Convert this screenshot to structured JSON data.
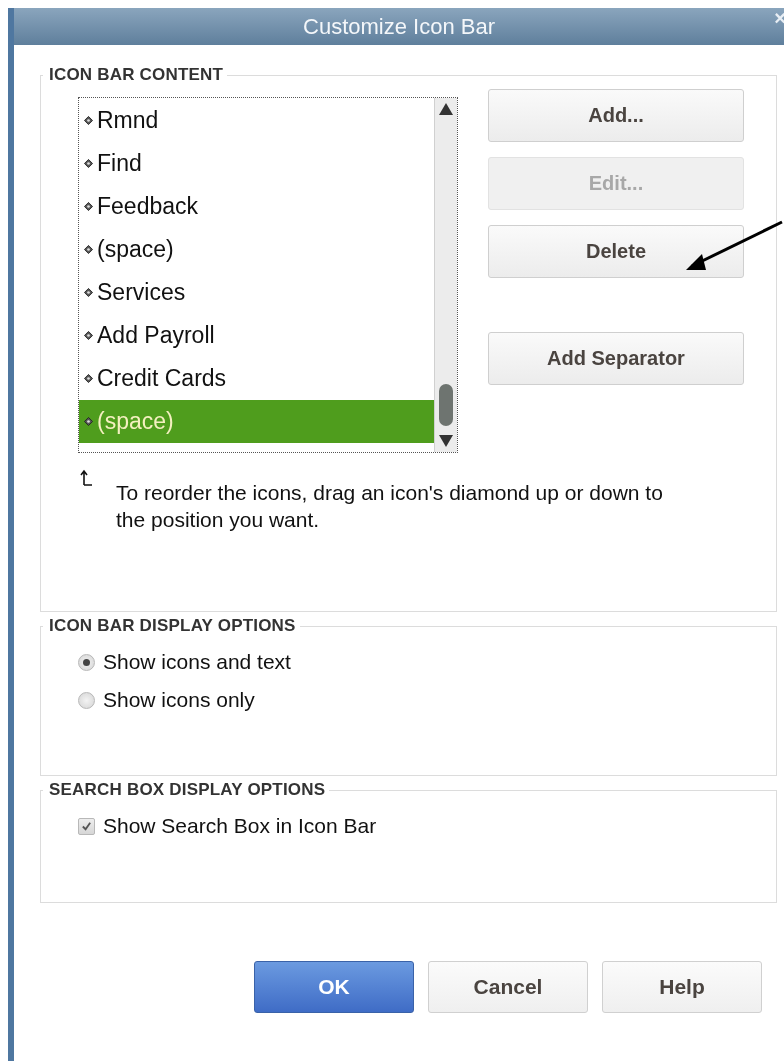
{
  "window": {
    "title": "Customize Icon Bar",
    "close": "×"
  },
  "icon_bar_content": {
    "title": "ICON BAR CONTENT",
    "items": [
      {
        "label": "Rmnd",
        "selected": false
      },
      {
        "label": "Find",
        "selected": false
      },
      {
        "label": "Feedback",
        "selected": false
      },
      {
        "label": "(space)",
        "selected": false
      },
      {
        "label": "Services",
        "selected": false
      },
      {
        "label": "Add Payroll",
        "selected": false
      },
      {
        "label": "Credit Cards",
        "selected": false
      },
      {
        "label": "(space)",
        "selected": true
      }
    ],
    "buttons": [
      {
        "label": "Add...",
        "disabled": false
      },
      {
        "label": "Edit...",
        "disabled": true
      },
      {
        "label": "Delete",
        "disabled": false
      },
      {
        "label": "Add Separator",
        "disabled": false
      }
    ],
    "hint": "To reorder the icons, drag an icon's diamond up or down to the position you want."
  },
  "icon_bar_display_options": {
    "title": "ICON BAR DISPLAY OPTIONS",
    "options": [
      {
        "label": "Show icons and text",
        "selected": true
      },
      {
        "label": "Show icons only",
        "selected": false
      }
    ]
  },
  "search_box_display_options": {
    "title": "SEARCH BOX DISPLAY OPTIONS",
    "checkbox": {
      "label": "Show Search Box in Icon Bar",
      "checked": true
    }
  },
  "footer_buttons": [
    {
      "label": "OK",
      "kind": "primary"
    },
    {
      "label": "Cancel",
      "kind": "normal"
    },
    {
      "label": "Help",
      "kind": "normal"
    }
  ]
}
